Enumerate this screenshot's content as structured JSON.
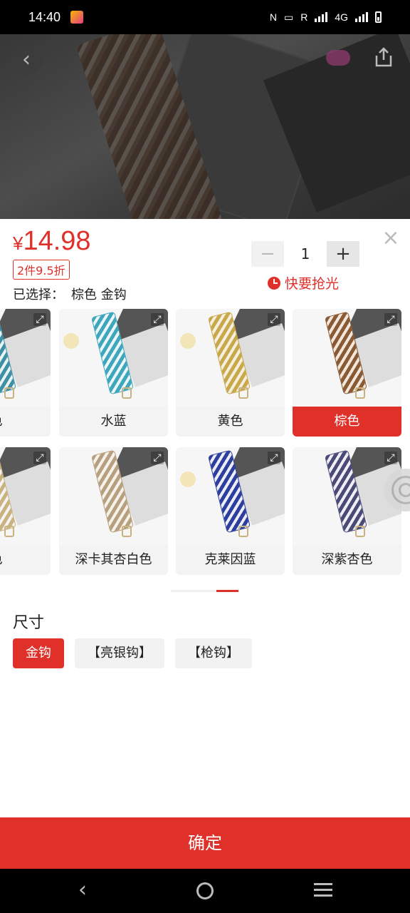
{
  "status_bar": {
    "time": "14:40",
    "carrier_letter": "R",
    "network": "4G",
    "icons": [
      "app-notification-icon",
      "nfc-icon",
      "cast-icon",
      "signal-icon",
      "battery-icon"
    ]
  },
  "hero": {
    "description_icons": [
      "back-arrow-icon",
      "share-icon"
    ]
  },
  "product": {
    "currency": "¥",
    "price": "14.98",
    "discount_tag": "2件9.5折",
    "selected_label": "已选择：",
    "selected_value": "棕色 金钩",
    "quantity": "1",
    "minus_symbol": "−",
    "plus_symbol": "+",
    "stock_warning": "快要抢光"
  },
  "variants": [
    {
      "label": "色",
      "colors": [
        "#3e8fa6",
        "#eaf3f3"
      ],
      "active": false
    },
    {
      "label": "水蓝",
      "colors": [
        "#3ea6bd",
        "#eef7f8"
      ],
      "active": false
    },
    {
      "label": "黄色",
      "colors": [
        "#c8a84a",
        "#f4efdf"
      ],
      "active": false
    },
    {
      "label": "棕色",
      "colors": [
        "#8a5a34",
        "#f1e7dc"
      ],
      "active": true
    },
    {
      "label": "色",
      "colors": [
        "#c9b27d",
        "#f3f3f3"
      ],
      "active": false
    },
    {
      "label": "深卡其杏白色",
      "colors": [
        "#b7a080",
        "#f6f2ea"
      ],
      "active": false
    },
    {
      "label": "克莱因蓝",
      "colors": [
        "#2d3f9e",
        "#ecedf6"
      ],
      "active": false
    },
    {
      "label": "深紫杏色",
      "colors": [
        "#4a4a78",
        "#eeeef3"
      ],
      "active": false
    }
  ],
  "size": {
    "title": "尺寸",
    "options": [
      {
        "label": "金钩",
        "active": true
      },
      {
        "label": "【亮银钩】",
        "active": false
      },
      {
        "label": "【枪钩】",
        "active": false
      }
    ]
  },
  "confirm_label": "确定",
  "accent_color": "#e0302a"
}
